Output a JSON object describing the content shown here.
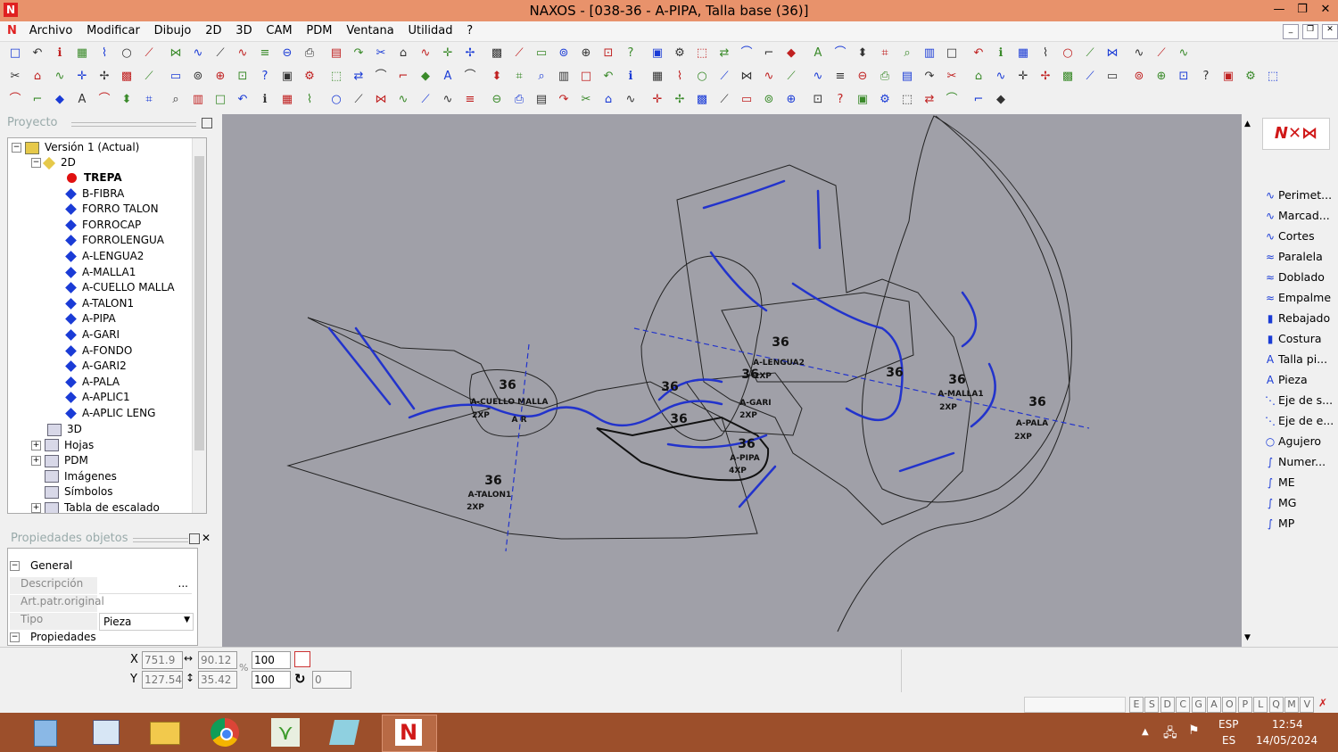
{
  "window": {
    "title": "NAXOS - [038-36 - A-PIPA, Talla base (36)]",
    "minimize": "—",
    "restore": "❐",
    "close": "✕"
  },
  "menu": [
    "Archivo",
    "Modificar",
    "Dibujo",
    "2D",
    "3D",
    "CAM",
    "PDM",
    "Ventana",
    "Utilidad",
    "?"
  ],
  "project": {
    "header": "Proyecto",
    "root": "Versión 1 (Actual)",
    "group2d": "2D",
    "pieces": [
      "TREPA",
      "B-FIBRA",
      "FORRO TALON",
      "FORROCAP",
      "FORROLENGUA",
      "A-LENGUA2",
      "A-MALLA1",
      "A-CUELLO MALLA",
      "A-TALON1",
      "A-PIPA",
      "A-GARI",
      "A-FONDO",
      "A-GARI2",
      "A-PALA",
      "A-APLIC1",
      "A-APLIC LENG"
    ],
    "others": [
      "3D",
      "Hojas",
      "PDM",
      "Imágenes",
      "Símbolos",
      "Tabla de escalado"
    ]
  },
  "properties": {
    "header": "Propiedades objetos",
    "group_general": "General",
    "descripcion": "Descripción",
    "art_patr": "Art.patr.original",
    "tipo_label": "Tipo",
    "tipo_value": "Pieza",
    "group_prop": "Propiedades",
    "ellipsis": "..."
  },
  "canvas_labels": [
    {
      "size": "36",
      "name": "A-CUELLO MALLA",
      "qty": "2XP"
    },
    {
      "size": "36",
      "name": "A-TALON1",
      "qty": "2XP"
    },
    {
      "size": "36",
      "name": "A-PIPA",
      "qty": "4XP"
    },
    {
      "size": "36",
      "name": "A-GARI",
      "qty": "2XP"
    },
    {
      "size": "36",
      "name": "A-LENGUA2",
      "qty": "2XP"
    },
    {
      "size": "36",
      "name": "A-MALLA1",
      "qty": "2XP"
    },
    {
      "size": "36",
      "name": "A-PALA",
      "qty": "2XP"
    }
  ],
  "canvas_misc": {
    "s1": "36",
    "s2": "36",
    "s3": "36",
    "s4": "36",
    "s5": "36",
    "apr": "A R"
  },
  "right_tools": [
    "Perimet...",
    "Marcad...",
    "Cortes",
    "Paralela",
    "Doblado",
    "Empalme",
    "Rebajado",
    "Costura",
    "Talla pi...",
    "Pieza",
    "Eje de s...",
    "Eje de e...",
    "Agujero",
    "Numer...",
    "ME",
    "MG",
    "MP"
  ],
  "right_icons": [
    "∿",
    "∿",
    "∿",
    "≈",
    "≈",
    "≈",
    "▮",
    "▮",
    "A",
    "A",
    "⋱",
    "⋱",
    "○",
    "∫",
    "∫",
    "∫",
    "∫"
  ],
  "coords": {
    "x_label": "X",
    "y_label": "Y",
    "x": "751.9",
    "y": "127.54",
    "w": "90.12",
    "h": "35.42",
    "sx": "100",
    "sy": "100",
    "rot": "0",
    "pct": "%"
  },
  "status_letters": [
    "E",
    "S",
    "D",
    "C",
    "G",
    "A",
    "O",
    "P",
    "L",
    "Q",
    "M",
    "V"
  ],
  "taskbar": {
    "lang1": "ESP",
    "lang2": "ES",
    "time": "12:54",
    "date": "14/05/2024"
  },
  "colors": {
    "titlebar": "#e8926b",
    "canvas": "#a0a0a8",
    "taskbar": "#9c4f2b",
    "accent": "#1a3bd6"
  }
}
